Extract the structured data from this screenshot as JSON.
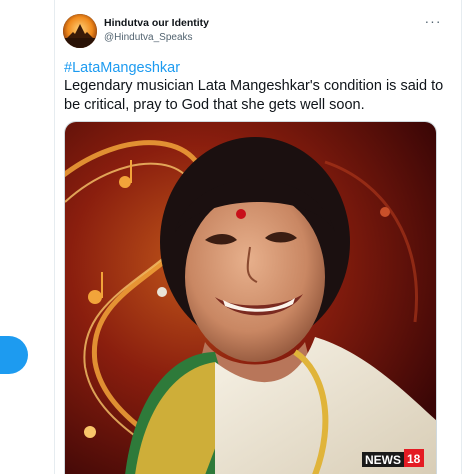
{
  "tweet": {
    "author_name": "Hindutva our Identity",
    "author_handle": "@Hindutva_Speaks",
    "hashtag": "#LataMangeshkar",
    "text": "Legendary musician Lata Mangeshkar's condition is said to be critical, pray to God that she gets well soon.",
    "more_icon": "ellipsis-icon"
  },
  "media": {
    "logo_text": "NEWS",
    "logo_number": "18"
  },
  "colors": {
    "link": "#1d9bf0",
    "text": "#0f1419",
    "secondary": "#536471",
    "logo_red": "#e41b23"
  }
}
